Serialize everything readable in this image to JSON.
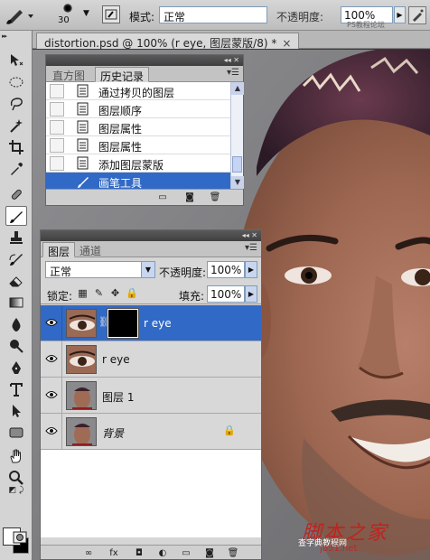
{
  "options_bar": {
    "brush_size": "30",
    "mode_label": "模式:",
    "mode_value": "正常",
    "opacity_label": "不透明度:",
    "opacity_value": "100%",
    "site_watermark": "PS教程论坛  BBS.16XX8.COM  WWW.MISSYUAN.COM"
  },
  "document_tab": {
    "title": "distortion.psd @ 100% (r eye, 图层蒙版/8) *",
    "close_glyph": "×"
  },
  "history_panel": {
    "tabs": [
      "直方图",
      "历史记录"
    ],
    "active_tab": "历史记录",
    "items": [
      {
        "label": "通过拷贝的图层",
        "selected": false
      },
      {
        "label": "图层顺序",
        "selected": false
      },
      {
        "label": "图层属性",
        "selected": false
      },
      {
        "label": "图层属性",
        "selected": false
      },
      {
        "label": "添加图层蒙版",
        "selected": false
      },
      {
        "label": "画笔工具",
        "selected": true
      }
    ]
  },
  "layers_panel": {
    "tabs": [
      "图层",
      "通道"
    ],
    "active_tab": "图层",
    "blend_mode": "正常",
    "opacity_label": "不透明度:",
    "opacity_value": "100%",
    "lock_label": "锁定:",
    "fill_label": "填充:",
    "fill_value": "100%",
    "layers": [
      {
        "name": "r eye",
        "visible": true,
        "selected": true,
        "has_mask": true,
        "locked": false,
        "thumb": "eye"
      },
      {
        "name": "r eye",
        "visible": true,
        "selected": false,
        "has_mask": false,
        "locked": false,
        "thumb": "eye"
      },
      {
        "name": "图层 1",
        "visible": true,
        "selected": false,
        "has_mask": false,
        "locked": false,
        "thumb": "face"
      },
      {
        "name": "背景",
        "visible": true,
        "selected": false,
        "has_mask": false,
        "locked": true,
        "thumb": "face"
      }
    ]
  },
  "watermark": {
    "main": "脚本之家",
    "sub": "jb51.net",
    "small": "查字典教程网"
  },
  "colors": {
    "selection_blue": "#3169c6",
    "foreground": "#ffffff",
    "background": "#000000",
    "watermark_red": "#c0231f"
  }
}
